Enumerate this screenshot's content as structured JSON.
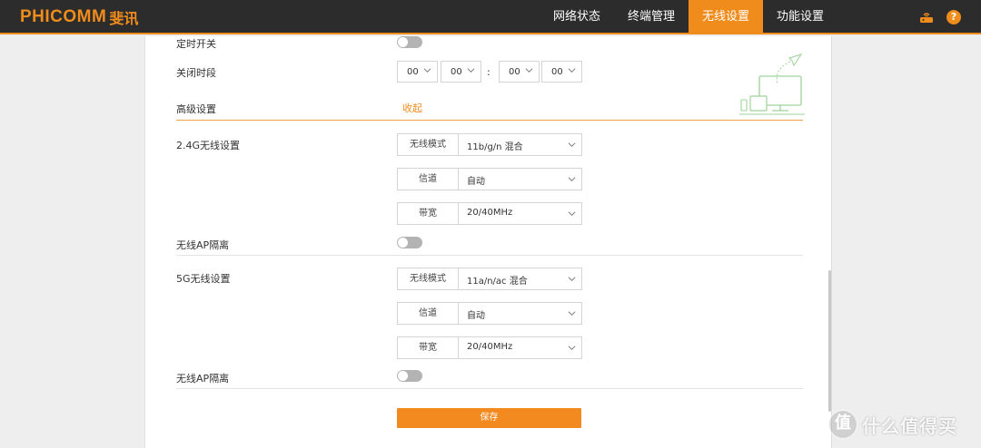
{
  "brand": {
    "name_en": "PHICOMM",
    "name_cn": "斐讯",
    "accent": "#f08c1c"
  },
  "nav": [
    {
      "label": "网络状态",
      "active": false
    },
    {
      "label": "终端管理",
      "active": false
    },
    {
      "label": "无线设置",
      "active": true
    },
    {
      "label": "功能设置",
      "active": false
    }
  ],
  "top_icons": {
    "router": "router-icon",
    "help": "?"
  },
  "schedule": {
    "timer_label": "定时开关",
    "timer_on": false,
    "period_label": "关闭时段",
    "start_hour": "00",
    "start_min": "00",
    "sep": ":",
    "end_hour": "00",
    "end_min": "00"
  },
  "advanced": {
    "label": "高级设置",
    "toggle_text": "收起"
  },
  "band24": {
    "title": "2.4G无线设置",
    "mode_label": "无线模式",
    "mode_value": "11b/g/n 混合",
    "channel_label": "信道",
    "channel_value": "自动",
    "bw_label": "带宽",
    "bw_value": "20/40MHz",
    "ap_iso_label": "无线AP隔离",
    "ap_iso_on": false
  },
  "band5": {
    "title": "5G无线设置",
    "mode_label": "无线模式",
    "mode_value": "11a/n/ac 混合",
    "channel_label": "信道",
    "channel_value": "自动",
    "bw_label": "带宽",
    "bw_value": "20/40MHz",
    "ap_iso_label": "无线AP隔离",
    "ap_iso_on": false
  },
  "save_label": "保存",
  "watermark": {
    "badge": "值",
    "text": "什么值得买"
  }
}
